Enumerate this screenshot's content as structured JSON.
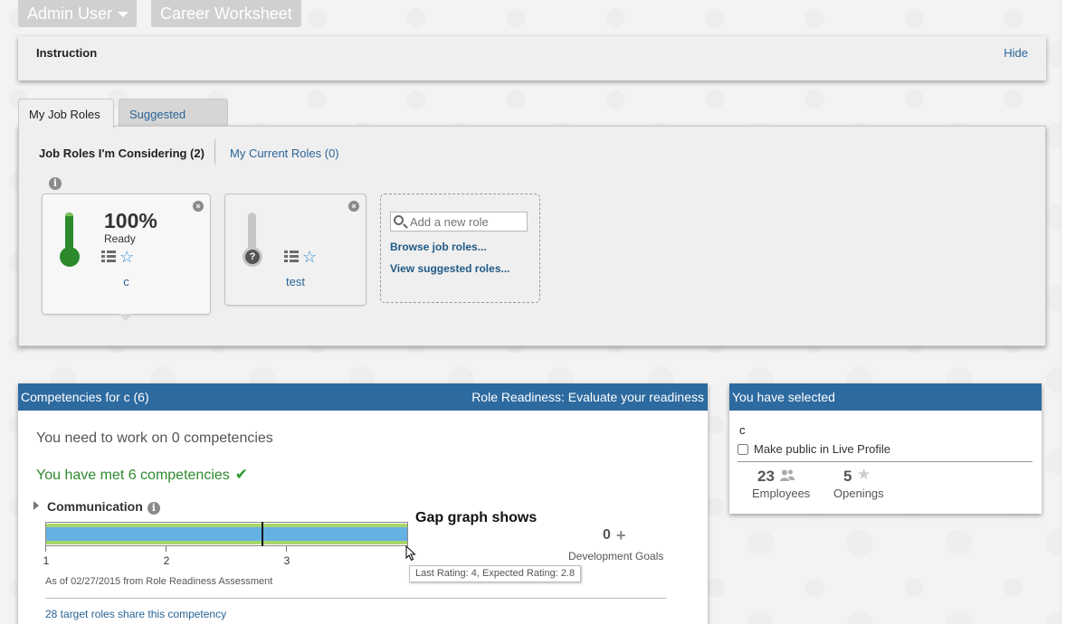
{
  "topnav": {
    "admin_label": "Admin User",
    "career_label": "Career Worksheet"
  },
  "instruction": {
    "title": "Instruction",
    "hide_label": "Hide"
  },
  "tabs": {
    "my_job_roles": "My Job Roles",
    "suggested_roles": "Suggested Roles"
  },
  "subtabs": {
    "considering": "Job Roles I'm Considering (2)",
    "current": "My Current Roles (0)"
  },
  "roles": [
    {
      "name": "c",
      "percent": "100%",
      "status": "Ready",
      "readiness": 1.0
    },
    {
      "name": "test",
      "percent": "",
      "status": "",
      "readiness": 0,
      "unknown_symbol": "?"
    }
  ],
  "add_role": {
    "placeholder": "Add a new role",
    "browse_label": "Browse job roles...",
    "suggested_label": "View suggested roles..."
  },
  "competencies": {
    "header_title": "Competencies for c (6)",
    "header_action": "Role Readiness: Evaluate your readiness",
    "need_work": "You need to work on 0 competencies",
    "met": "You have met 6 competencies",
    "item": {
      "name": "Communication",
      "last_rating": 4,
      "expected_rating": 2.8,
      "scale_ticks": [
        "1",
        "2",
        "3"
      ],
      "scale_min": 1,
      "scale_max": 4,
      "development_goals_count": "0",
      "development_goals_label": "Development Goals",
      "as_of": "As of 02/27/2015 from Role Readiness Assessment",
      "share_link": "28 target roles share this competency",
      "tooltip": "Last Rating: 4, Expected Rating: 2.8"
    },
    "annotation": "Gap graph shows"
  },
  "selected": {
    "header": "You have selected",
    "role": "c",
    "make_public": "Make public in Live Profile",
    "employees_count": "23",
    "employees_label": "Employees",
    "openings_count": "5",
    "openings_label": "Openings"
  },
  "colors": {
    "header_blue": "#2d6aa0",
    "link_blue": "#2a6496",
    "ready_green": "#2c8a2c",
    "gap_blue": "#63b2e3",
    "gap_green": "#a8d66a"
  }
}
